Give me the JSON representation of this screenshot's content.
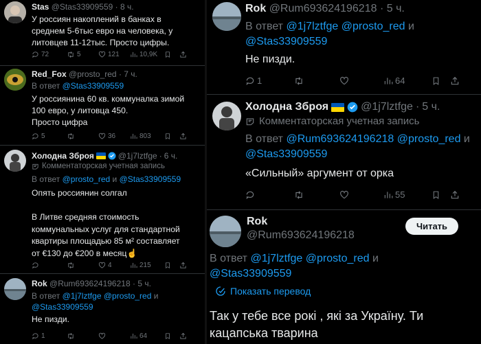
{
  "colors": {
    "bg": "#000000",
    "text": "#e7e9ea",
    "muted": "#71767b",
    "link": "#1d9bf0",
    "divider": "#2f3336"
  },
  "left": {
    "t1": {
      "name": "Stas",
      "handle": "@Stas33909559",
      "dot": "·",
      "time": "8 ч.",
      "lines": [
        "У россиян накоплений в банках в",
        "среднем 5-6тыс евро на человека, у",
        "литовцев 11-12тыс. Просто цифры."
      ],
      "stats": {
        "replies": "72",
        "reposts": "5",
        "likes": "121",
        "views": "10,9K"
      }
    },
    "t2": {
      "name": "Red_Fox",
      "handle": "@prosto_red",
      "dot": "·",
      "time": "7 ч.",
      "reply_prefix": "В ответ",
      "reply_to": "@Stas33909559",
      "lines": [
        "У россиянина 60 кв.  коммуналка зимой",
        "100 евро,  у литовца 450.",
        "Просто цифра"
      ],
      "stats": {
        "replies": "5",
        "reposts": "",
        "likes": "36",
        "views": "803"
      }
    },
    "t3": {
      "name": "Холодна Зброя",
      "handle": "@1j7lztfge",
      "dot": "·",
      "time": "6 ч.",
      "commentator": "Комментаторская учетная запись",
      "reply_prefix": "В ответ",
      "reply_to_1": "@prosto_red",
      "reply_and": "и",
      "reply_to_2": "@Stas33909559",
      "lines": [
        "Опять россиянин солгал",
        "",
        "В Литве средняя стоимость",
        "коммунальных услуг для стандартной",
        "квартиры площадью 85 м² составляет",
        "от €130 до €200 в месяц☝️"
      ],
      "stats": {
        "replies": "",
        "reposts": "",
        "likes": "4",
        "views": "215"
      }
    },
    "t4": {
      "name": "Rok",
      "handle": "@Rum693624196218",
      "dot": "·",
      "time": "5 ч.",
      "reply_prefix": "В ответ",
      "reply_to_1": "@1j7lztfge",
      "reply_to_2": "@prosto_red",
      "reply_and": "и",
      "reply_to_3": "@Stas33909559",
      "lines": [
        "Не пизди."
      ],
      "stats": {
        "replies": "1",
        "reposts": "",
        "likes": "",
        "views": "64"
      }
    }
  },
  "right": {
    "t1": {
      "name": "Rok",
      "handle": "@Rum693624196218",
      "dot": "·",
      "time": "5 ч.",
      "reply_prefix": "В ответ",
      "reply_to_1": "@1j7lztfge",
      "reply_to_2": "@prosto_red",
      "reply_and": "и",
      "reply_to_3": "@Stas33909559",
      "lines": [
        "Не пизди."
      ],
      "stats": {
        "replies": "1",
        "reposts": "",
        "likes": "",
        "views": "64"
      }
    },
    "t2": {
      "name": "Холодна Зброя",
      "handle": "@1j7lztfge",
      "dot": "·",
      "time": "5 ч.",
      "commentator": "Комментаторская учетная запись",
      "reply_prefix": "В ответ",
      "reply_to_1": "@Rum693624196218",
      "reply_to_2": "@prosto_red",
      "reply_and": "и",
      "reply_to_3": "@Stas33909559",
      "lines": [
        "«Сильный» аргумент от орка"
      ],
      "stats": {
        "replies": "",
        "reposts": "",
        "likes": "",
        "views": "55"
      }
    },
    "t3": {
      "name": "Rok",
      "handle": "@Rum693624196218",
      "read_button": "Читать",
      "reply_prefix": "В ответ",
      "reply_to_1": "@1j7lztfge",
      "reply_to_2": "@prosto_red",
      "reply_and": "и",
      "reply_to_3": "@Stas33909559",
      "translate": "Показать перевод",
      "lines": [
        "Так у тебе все рокі , які за Україну. Ти",
        "кацапська тварина"
      ]
    }
  }
}
